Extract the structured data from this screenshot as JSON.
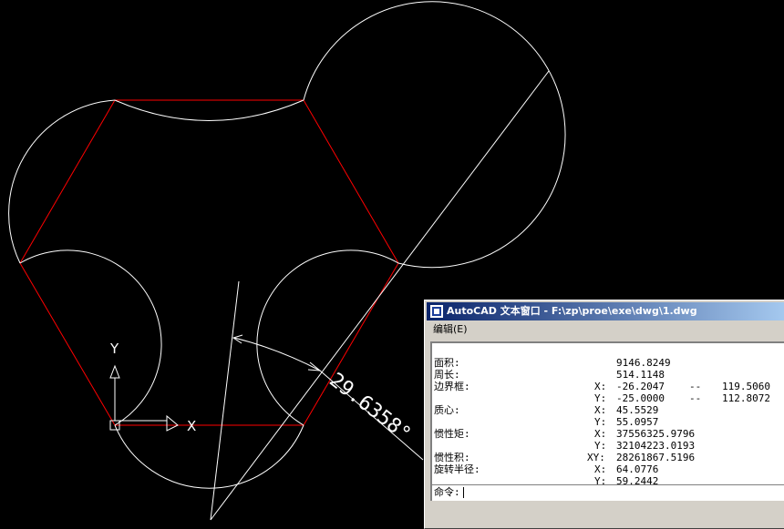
{
  "drawing": {
    "dimension_text": "29.6358°",
    "ucs_x_label": "X",
    "ucs_y_label": "Y"
  },
  "text_window": {
    "title": "AutoCAD 文本窗口 - F:\\zp\\proe\\exe\\dwg\\1.dwg",
    "menu": [
      "编辑(E)"
    ],
    "rows": [
      {
        "label": "面积:",
        "axis": "",
        "value": "9146.8249",
        "sep": "",
        "value2": ""
      },
      {
        "label": "周长:",
        "axis": "",
        "value": "514.1148",
        "sep": "",
        "value2": ""
      },
      {
        "label": "边界框:",
        "axis": "X:",
        "value": "-26.2047",
        "sep": "--",
        "value2": "119.5060"
      },
      {
        "label": "",
        "axis": "Y:",
        "value": "-25.0000",
        "sep": "--",
        "value2": "112.8072"
      },
      {
        "label": "质心:",
        "axis": "X:",
        "value": "45.5529",
        "sep": "",
        "value2": ""
      },
      {
        "label": "",
        "axis": "Y:",
        "value": "55.0957",
        "sep": "",
        "value2": ""
      },
      {
        "label": "惯性矩:",
        "axis": "X:",
        "value": "37556325.9796",
        "sep": "",
        "value2": ""
      },
      {
        "label": "",
        "axis": "Y:",
        "value": "32104223.0193",
        "sep": "",
        "value2": ""
      },
      {
        "label": "惯性积:",
        "axis": "XY:",
        "value": "28261867.5196",
        "sep": "",
        "value2": ""
      },
      {
        "label": "旋转半径:",
        "axis": "X:",
        "value": "64.0776",
        "sep": "",
        "value2": ""
      },
      {
        "label": "",
        "axis": "Y:",
        "value": "59.2442",
        "sep": "",
        "value2": ""
      }
    ],
    "command_prompt": "命令:"
  },
  "colors": {
    "model_background": "#000000",
    "arc_lines": "#ffffff",
    "hexagon_lines": "#ff0000",
    "title_bar_start": "#0a246a",
    "title_bar_end": "#a6caf0"
  }
}
